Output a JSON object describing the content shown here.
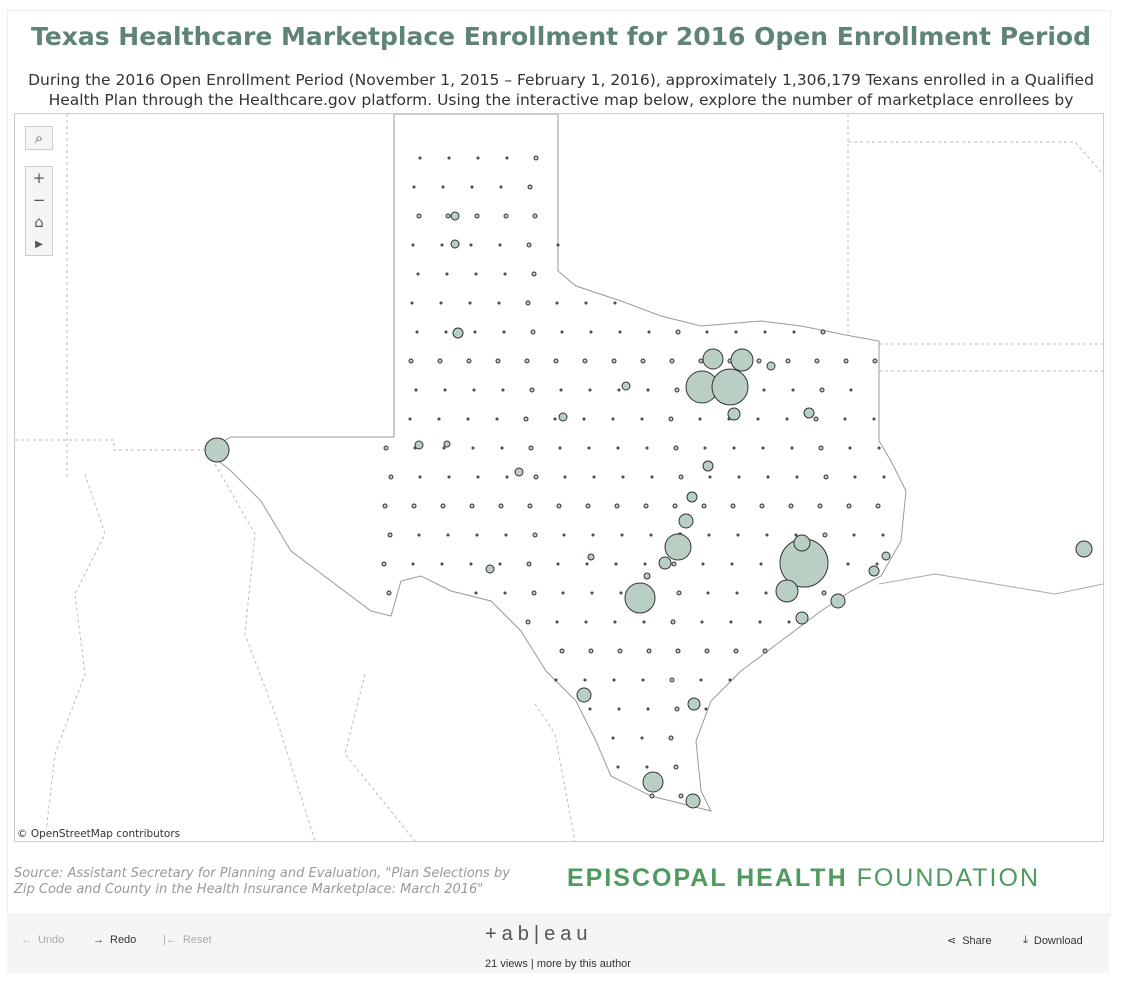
{
  "header": {
    "title": "Texas Healthcare Marketplace Enrollment for 2016 Open Enrollment Period",
    "description": "During the 2016 Open Enrollment Period (November 1, 2015 – February 1, 2016), approximately 1,306,179 Texans enrolled in a Qualified Health Plan through the Healthcare.gov platform. Using the interactive map below, explore the number of marketplace enrollees by county."
  },
  "map": {
    "attribution": "© OpenStreetMap contributors",
    "mark_color": "#b9cfc4",
    "controls": {
      "search": "search-icon",
      "zoom_in": "+",
      "zoom_out": "−",
      "home": "home-icon",
      "expand": "play-icon"
    }
  },
  "footer": {
    "source": "Source: Assistant Secretary for Planning and Evaluation, \"Plan Selections by Zip Code and County in the Health Insurance Marketplace: March 2016\"",
    "logo_bold": "EPISCOPAL HEALTH",
    "logo_light": " FOUNDATION"
  },
  "toolbar": {
    "undo": "Undo",
    "redo": "Redo",
    "reset": "Reset",
    "brand": "+ab|eau",
    "views": "21 views",
    "more": "more by this author",
    "share": "Share",
    "download": "Download"
  }
}
